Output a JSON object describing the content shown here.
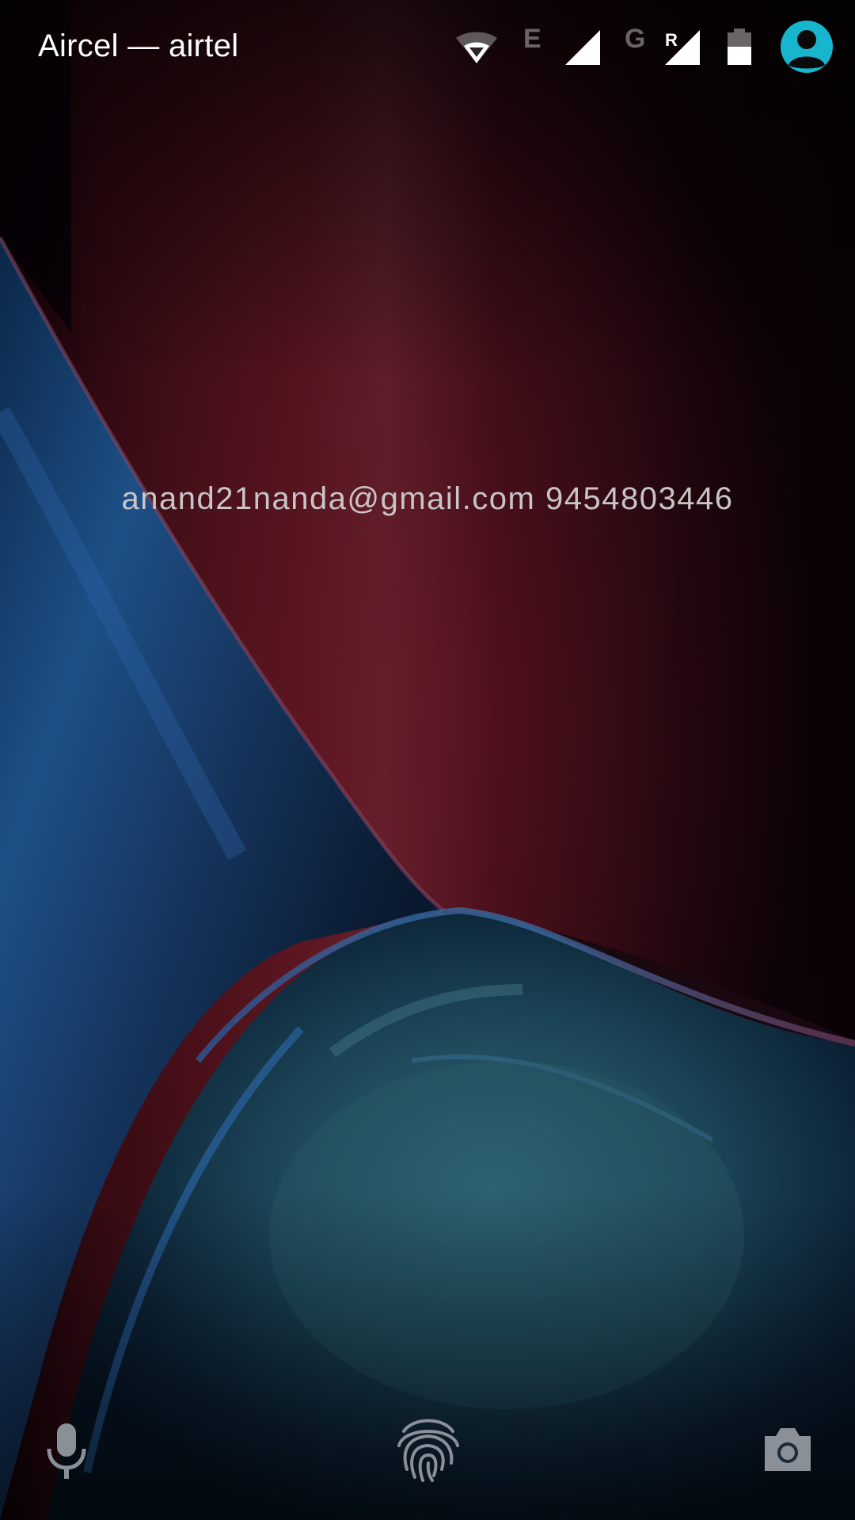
{
  "status_bar": {
    "carrier": "Aircel — airtel",
    "network_indicator_1": "E",
    "network_indicator_2": "G",
    "roaming_indicator": "R",
    "icons": [
      "wifi-icon",
      "signal-strength-icon",
      "signal-strength-roaming-icon",
      "battery-icon",
      "user-avatar-icon"
    ],
    "battery_level": 0.55,
    "avatar_color": "#18b5cf"
  },
  "lockscreen": {
    "owner_info": "anand21nanda@gmail.com 9454803446"
  },
  "bottom_bar": {
    "left_icon": "microphone-icon",
    "center_icon": "fingerprint-icon",
    "right_icon": "camera-icon"
  },
  "colors": {
    "wallpaper_red": "#6a1622",
    "wallpaper_blue": "#1f4f86",
    "wallpaper_teal": "#2a5a6e",
    "owner_text": "#c9c4c8"
  }
}
